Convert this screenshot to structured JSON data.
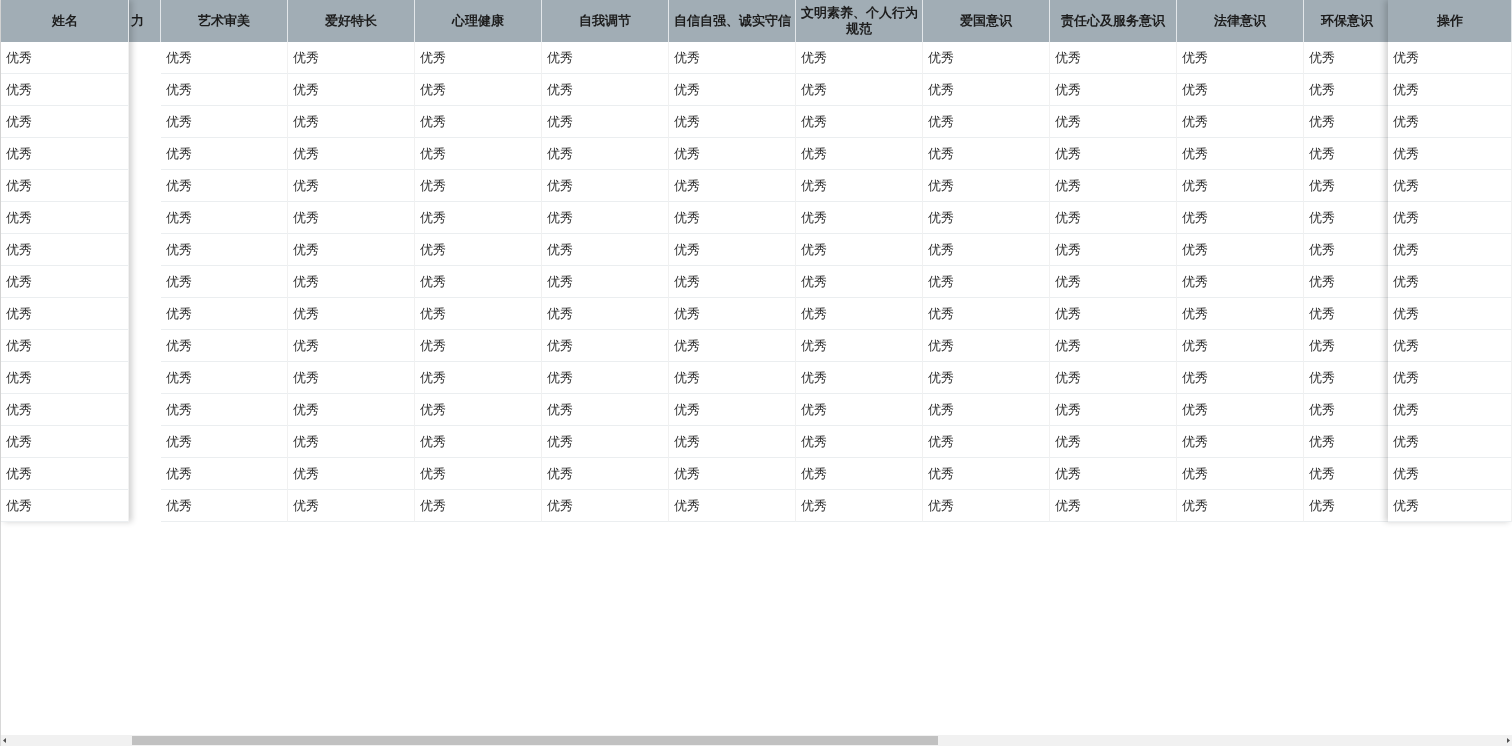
{
  "table": {
    "fixed_left": {
      "label": "姓名"
    },
    "columns": [
      {
        "label": "力"
      },
      {
        "label": "艺术审美"
      },
      {
        "label": "爱好特长"
      },
      {
        "label": "心理健康"
      },
      {
        "label": "自我调节"
      },
      {
        "label": "自信自强、诚实守信"
      },
      {
        "label": "文明素养、个人行为规范"
      },
      {
        "label": "爱国意识"
      },
      {
        "label": "责任心及服务意识"
      },
      {
        "label": "法律意识"
      },
      {
        "label": "环保意识"
      }
    ],
    "fixed_right": {
      "label": "操作"
    },
    "rows": [
      {
        "name": "优秀",
        "scores": [
          "优秀",
          "优秀",
          "优秀",
          "优秀",
          "优秀",
          "优秀",
          "优秀",
          "优秀",
          "优秀",
          "优秀"
        ],
        "action": "优秀"
      },
      {
        "name": "优秀",
        "scores": [
          "优秀",
          "优秀",
          "优秀",
          "优秀",
          "优秀",
          "优秀",
          "优秀",
          "优秀",
          "优秀",
          "优秀"
        ],
        "action": "优秀"
      },
      {
        "name": "优秀",
        "scores": [
          "优秀",
          "优秀",
          "优秀",
          "优秀",
          "优秀",
          "优秀",
          "优秀",
          "优秀",
          "优秀",
          "优秀"
        ],
        "action": "优秀"
      },
      {
        "name": "优秀",
        "scores": [
          "优秀",
          "优秀",
          "优秀",
          "优秀",
          "优秀",
          "优秀",
          "优秀",
          "优秀",
          "优秀",
          "优秀"
        ],
        "action": "优秀"
      },
      {
        "name": "优秀",
        "scores": [
          "优秀",
          "优秀",
          "优秀",
          "优秀",
          "优秀",
          "优秀",
          "优秀",
          "优秀",
          "优秀",
          "优秀"
        ],
        "action": "优秀"
      },
      {
        "name": "优秀",
        "scores": [
          "优秀",
          "优秀",
          "优秀",
          "优秀",
          "优秀",
          "优秀",
          "优秀",
          "优秀",
          "优秀",
          "优秀"
        ],
        "action": "优秀"
      },
      {
        "name": "优秀",
        "scores": [
          "优秀",
          "优秀",
          "优秀",
          "优秀",
          "优秀",
          "优秀",
          "优秀",
          "优秀",
          "优秀",
          "优秀"
        ],
        "action": "优秀"
      },
      {
        "name": "优秀",
        "scores": [
          "优秀",
          "优秀",
          "优秀",
          "优秀",
          "优秀",
          "优秀",
          "优秀",
          "优秀",
          "优秀",
          "优秀"
        ],
        "action": "优秀"
      },
      {
        "name": "优秀",
        "scores": [
          "优秀",
          "优秀",
          "优秀",
          "优秀",
          "优秀",
          "优秀",
          "优秀",
          "优秀",
          "优秀",
          "优秀"
        ],
        "action": "优秀"
      },
      {
        "name": "优秀",
        "scores": [
          "优秀",
          "优秀",
          "优秀",
          "优秀",
          "优秀",
          "优秀",
          "优秀",
          "优秀",
          "优秀",
          "优秀"
        ],
        "action": "优秀"
      },
      {
        "name": "优秀",
        "scores": [
          "优秀",
          "优秀",
          "优秀",
          "优秀",
          "优秀",
          "优秀",
          "优秀",
          "优秀",
          "优秀",
          "优秀"
        ],
        "action": "优秀"
      },
      {
        "name": "优秀",
        "scores": [
          "优秀",
          "优秀",
          "优秀",
          "优秀",
          "优秀",
          "优秀",
          "优秀",
          "优秀",
          "优秀",
          "优秀"
        ],
        "action": "优秀"
      },
      {
        "name": "优秀",
        "scores": [
          "优秀",
          "优秀",
          "优秀",
          "优秀",
          "优秀",
          "优秀",
          "优秀",
          "优秀",
          "优秀",
          "优秀"
        ],
        "action": "优秀"
      },
      {
        "name": "优秀",
        "scores": [
          "优秀",
          "优秀",
          "优秀",
          "优秀",
          "优秀",
          "优秀",
          "优秀",
          "优秀",
          "优秀",
          "优秀"
        ],
        "action": "优秀"
      },
      {
        "name": "优秀",
        "scores": [
          "优秀",
          "优秀",
          "优秀",
          "优秀",
          "优秀",
          "优秀",
          "优秀",
          "优秀",
          "优秀",
          "优秀"
        ],
        "action": "优秀"
      }
    ]
  }
}
